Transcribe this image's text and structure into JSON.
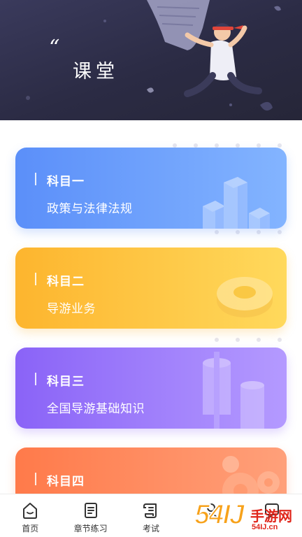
{
  "banner": {
    "quote_mark": "“",
    "title": "课堂"
  },
  "courses": [
    {
      "label": "科目一",
      "subtitle": "政策与法律法规",
      "color": "#5b8ff9",
      "icon": "bar-chart-3d-icon"
    },
    {
      "label": "科目二",
      "subtitle": "导游业务",
      "color": "#fdb52e",
      "icon": "donut-3d-icon"
    },
    {
      "label": "科目三",
      "subtitle": "全国导游基础知识",
      "color": "#8a63f7",
      "icon": "cylinders-3d-icon"
    },
    {
      "label": "科目四",
      "subtitle": "",
      "color": "#ff7a4a",
      "icon": "gears-3d-icon"
    }
  ],
  "nav": [
    {
      "label": "首页",
      "icon": "home-icon"
    },
    {
      "label": "章节练习",
      "icon": "document-icon"
    },
    {
      "label": "考试",
      "icon": "scroll-icon"
    },
    {
      "label": "",
      "icon": "profile-icon"
    },
    {
      "label": "",
      "icon": "message-icon"
    }
  ],
  "watermark": {
    "number": "54IJ",
    "text": "手游网",
    "domain": "54IJ.cn"
  }
}
